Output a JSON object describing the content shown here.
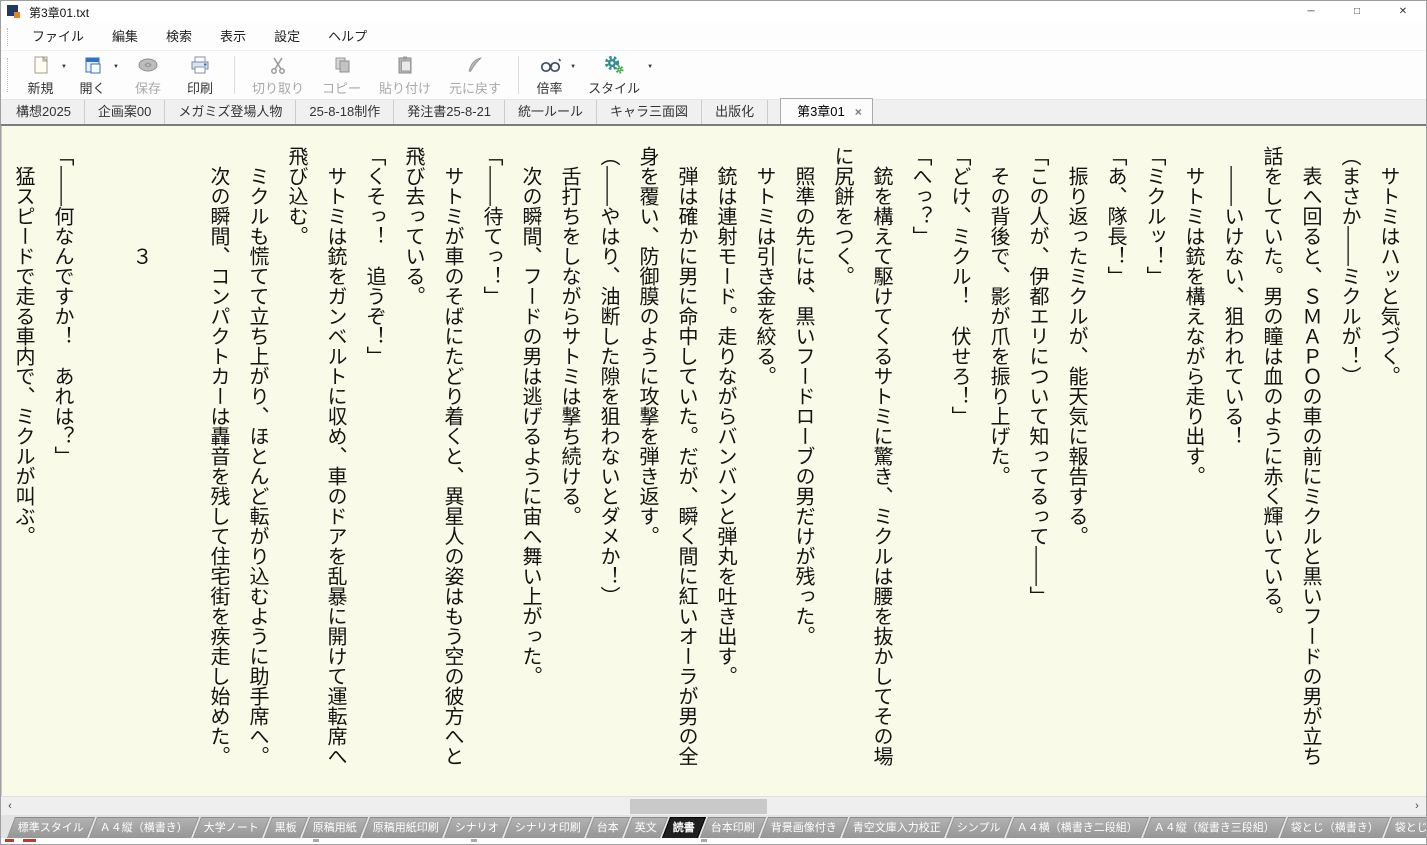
{
  "window": {
    "title": "第3章01.txt",
    "minimize_glyph": "─",
    "maximize_glyph": "□",
    "close_glyph": "✕"
  },
  "menu": {
    "items": [
      {
        "id": "file",
        "label": "ファイル"
      },
      {
        "id": "edit",
        "label": "編集"
      },
      {
        "id": "search",
        "label": "検索"
      },
      {
        "id": "view",
        "label": "表示"
      },
      {
        "id": "settings",
        "label": "設定"
      },
      {
        "id": "help",
        "label": "ヘルプ"
      }
    ]
  },
  "toolbar": {
    "dropdown_glyph": "▼",
    "buttons": [
      {
        "id": "new",
        "label": "新規",
        "enabled": true,
        "dropdown": true
      },
      {
        "id": "open",
        "label": "開く",
        "enabled": true,
        "dropdown": true
      },
      {
        "id": "save",
        "label": "保存",
        "enabled": false,
        "dropdown": false
      },
      {
        "id": "print",
        "label": "印刷",
        "enabled": true,
        "dropdown": false
      },
      {
        "id": "cut",
        "label": "切り取り",
        "enabled": false,
        "dropdown": false
      },
      {
        "id": "copy",
        "label": "コピー",
        "enabled": false,
        "dropdown": false
      },
      {
        "id": "paste",
        "label": "貼り付け",
        "enabled": false,
        "dropdown": false
      },
      {
        "id": "undo",
        "label": "元に戻す",
        "enabled": false,
        "dropdown": false
      },
      {
        "id": "zoom",
        "label": "倍率",
        "enabled": true,
        "dropdown": true
      },
      {
        "id": "style",
        "label": "スタイル",
        "enabled": true,
        "dropdown": true
      }
    ]
  },
  "doc_tabs": {
    "close_glyph": "×",
    "tabs": [
      {
        "label": "構想2025",
        "active": false
      },
      {
        "label": "企画案00",
        "active": false
      },
      {
        "label": "メガミズ登場人物",
        "active": false
      },
      {
        "label": "25-8-18制作",
        "active": false
      },
      {
        "label": "発注書25-8-21",
        "active": false
      },
      {
        "label": "統一ルール",
        "active": false
      },
      {
        "label": "キャラ三面図",
        "active": false
      },
      {
        "label": "出版化",
        "active": false
      },
      {
        "label": "第3章01",
        "active": true
      }
    ]
  },
  "document": {
    "lines": [
      "　サトミはハッと気づく。",
      "（まさか――ミクルが！）",
      "　表へ回ると、ＳＭＡＰＯの車の前にミクルと黒いフードの男が立ち話をしていた。男の瞳は血のように赤く輝いている。",
      "　――いけない、狙われている！",
      "　サトミは銃を構えながら走り出す。",
      "「ミクルッ！」",
      "「あ、隊長！」",
      "　振り返ったミクルが、能天気に報告する。",
      "「この人が、伊都エリについて知ってるって――」",
      "　その背後で、影が爪を振り上げた。",
      "「どけ、ミクル！　伏せろ！」",
      "「へっ？」",
      "　銃を構えて駆けてくるサトミに驚き、ミクルは腰を抜かしてその場に尻餅をつく。",
      "　照準の先には、黒いフードローブの男だけが残った。",
      "　サトミは引き金を絞る。",
      "　銃は連射モード。走りながらバンバンと弾丸を吐き出す。",
      "　弾は確かに男に命中していた。だが、瞬く間に紅いオーラが男の全身を覆い、防御膜のように攻撃を弾き返す。",
      "（――やはり、油断した隙を狙わないとダメか！）",
      "　舌打ちをしながらサトミは撃ち続ける。",
      "　次の瞬間、フードの男は逃げるように宙へ舞い上がった。",
      "「――待てっ！」",
      "　サトミが車のそばにたどり着くと、異星人の姿はもう空の彼方へと飛び去っている。",
      "「くそっ！　追うぞ！」",
      "　サトミは銃をガンベルトに収め、車のドアを乱暴に開けて運転席へ飛び込む。",
      "　ミクルも慌てて立ち上がり、ほとんど転がり込むように助手席へ。",
      "　次の瞬間、コンパクトカーは轟音を残して住宅街を疾走し始めた。",
      "",
      "　　　　　３",
      "",
      "「――何なんですか！　あれは？」",
      "　猛スピードで走る車内で、ミクルが叫ぶ。"
    ]
  },
  "scrollbar": {
    "left_glyph": "‹",
    "right_glyph": "›"
  },
  "style_tabs": {
    "tabs": [
      {
        "label": "標準スタイル",
        "active": false
      },
      {
        "label": "Ａ４縦（横書き）",
        "active": false
      },
      {
        "label": "大学ノート",
        "active": false
      },
      {
        "label": "黒板",
        "active": false
      },
      {
        "label": "原稿用紙",
        "active": false
      },
      {
        "label": "原稿用紙印刷",
        "active": false
      },
      {
        "label": "シナリオ",
        "active": false
      },
      {
        "label": "シナリオ印刷",
        "active": false
      },
      {
        "label": "台本",
        "active": false
      },
      {
        "label": "英文",
        "active": false
      },
      {
        "label": "読書",
        "active": true
      },
      {
        "label": "台本印刷",
        "active": false
      },
      {
        "label": "背景画像付き",
        "active": false
      },
      {
        "label": "青空文庫入力校正",
        "active": false
      },
      {
        "label": "シンプル",
        "active": false
      },
      {
        "label": "Ａ４横（横書き二段組）",
        "active": false
      },
      {
        "label": "Ａ４縦（縦書き三段組）",
        "active": false
      },
      {
        "label": "袋とじ（横書き）",
        "active": false
      },
      {
        "label": "袋とじ（縦書き）",
        "active": false
      }
    ]
  },
  "colors": {
    "content_bg": "#fafae8",
    "active_style_tab_bg": "#1f1f1f",
    "style_tab_bg": "#a2a2a2",
    "accent_blue": "#2f6fce",
    "accent_teal": "#2f8f8f",
    "accent_green": "#3aa63a"
  }
}
